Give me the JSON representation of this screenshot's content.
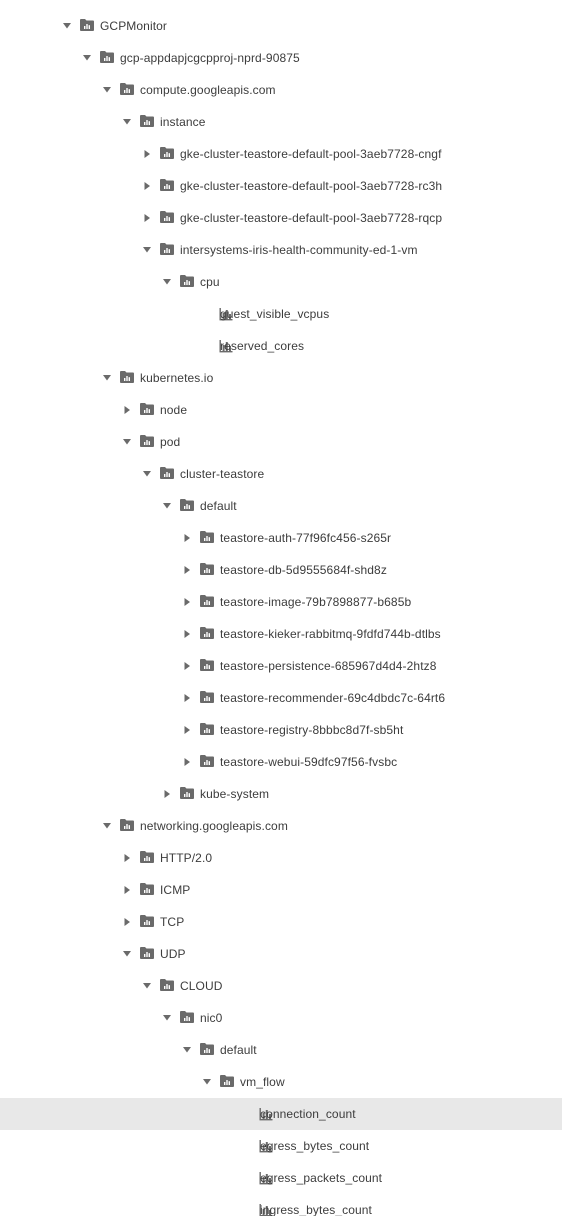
{
  "colors": {
    "icon": "#6a6a6a",
    "text": "#3c3c3c",
    "selected_row": "#e8e8e8",
    "background": "#ffffff"
  },
  "tree": [
    {
      "label": "GCPMonitor",
      "depth": 0,
      "type": "folder",
      "state": "expanded"
    },
    {
      "label": "gcp-appdapjcgcpproj-nprd-90875",
      "depth": 1,
      "type": "folder",
      "state": "expanded"
    },
    {
      "label": "compute.googleapis.com",
      "depth": 2,
      "type": "folder",
      "state": "expanded"
    },
    {
      "label": "instance",
      "depth": 3,
      "type": "folder",
      "state": "expanded"
    },
    {
      "label": "gke-cluster-teastore-default-pool-3aeb7728-cngf",
      "depth": 4,
      "type": "folder",
      "state": "collapsed"
    },
    {
      "label": "gke-cluster-teastore-default-pool-3aeb7728-rc3h",
      "depth": 4,
      "type": "folder",
      "state": "collapsed"
    },
    {
      "label": "gke-cluster-teastore-default-pool-3aeb7728-rqcp",
      "depth": 4,
      "type": "folder",
      "state": "collapsed"
    },
    {
      "label": "intersystems-iris-health-community-ed-1-vm",
      "depth": 4,
      "type": "folder",
      "state": "expanded"
    },
    {
      "label": "cpu",
      "depth": 5,
      "type": "folder",
      "state": "expanded"
    },
    {
      "label": "guest_visible_vcpus",
      "depth": 6,
      "type": "metric"
    },
    {
      "label": "reserved_cores",
      "depth": 6,
      "type": "metric"
    },
    {
      "label": "kubernetes.io",
      "depth": 2,
      "type": "folder",
      "state": "expanded"
    },
    {
      "label": "node",
      "depth": 3,
      "type": "folder",
      "state": "collapsed"
    },
    {
      "label": "pod",
      "depth": 3,
      "type": "folder",
      "state": "expanded"
    },
    {
      "label": "cluster-teastore",
      "depth": 4,
      "type": "folder",
      "state": "expanded"
    },
    {
      "label": "default",
      "depth": 5,
      "type": "folder",
      "state": "expanded"
    },
    {
      "label": "teastore-auth-77f96fc456-s265r",
      "depth": 6,
      "type": "folder",
      "state": "collapsed"
    },
    {
      "label": "teastore-db-5d9555684f-shd8z",
      "depth": 6,
      "type": "folder",
      "state": "collapsed"
    },
    {
      "label": "teastore-image-79b7898877-b685b",
      "depth": 6,
      "type": "folder",
      "state": "collapsed"
    },
    {
      "label": "teastore-kieker-rabbitmq-9fdfd744b-dtlbs",
      "depth": 6,
      "type": "folder",
      "state": "collapsed"
    },
    {
      "label": "teastore-persistence-685967d4d4-2htz8",
      "depth": 6,
      "type": "folder",
      "state": "collapsed"
    },
    {
      "label": "teastore-recommender-69c4dbdc7c-64rt6",
      "depth": 6,
      "type": "folder",
      "state": "collapsed"
    },
    {
      "label": "teastore-registry-8bbbc8d7f-sb5ht",
      "depth": 6,
      "type": "folder",
      "state": "collapsed"
    },
    {
      "label": "teastore-webui-59dfc97f56-fvsbc",
      "depth": 6,
      "type": "folder",
      "state": "collapsed"
    },
    {
      "label": "kube-system",
      "depth": 5,
      "type": "folder",
      "state": "collapsed"
    },
    {
      "label": "networking.googleapis.com",
      "depth": 2,
      "type": "folder",
      "state": "expanded"
    },
    {
      "label": "HTTP/2.0",
      "depth": 3,
      "type": "folder",
      "state": "collapsed"
    },
    {
      "label": "ICMP",
      "depth": 3,
      "type": "folder",
      "state": "collapsed"
    },
    {
      "label": "TCP",
      "depth": 3,
      "type": "folder",
      "state": "collapsed"
    },
    {
      "label": "UDP",
      "depth": 3,
      "type": "folder",
      "state": "expanded"
    },
    {
      "label": "CLOUD",
      "depth": 4,
      "type": "folder",
      "state": "expanded"
    },
    {
      "label": "nic0",
      "depth": 5,
      "type": "folder",
      "state": "expanded"
    },
    {
      "label": "default",
      "depth": 6,
      "type": "folder",
      "state": "expanded"
    },
    {
      "label": "vm_flow",
      "depth": 7,
      "type": "folder",
      "state": "expanded"
    },
    {
      "label": "connection_count",
      "depth": 8,
      "type": "metric",
      "selected": true
    },
    {
      "label": "egress_bytes_count",
      "depth": 8,
      "type": "metric"
    },
    {
      "label": "egress_packets_count",
      "depth": 8,
      "type": "metric"
    },
    {
      "label": "ingress_bytes_count",
      "depth": 8,
      "type": "metric"
    }
  ]
}
